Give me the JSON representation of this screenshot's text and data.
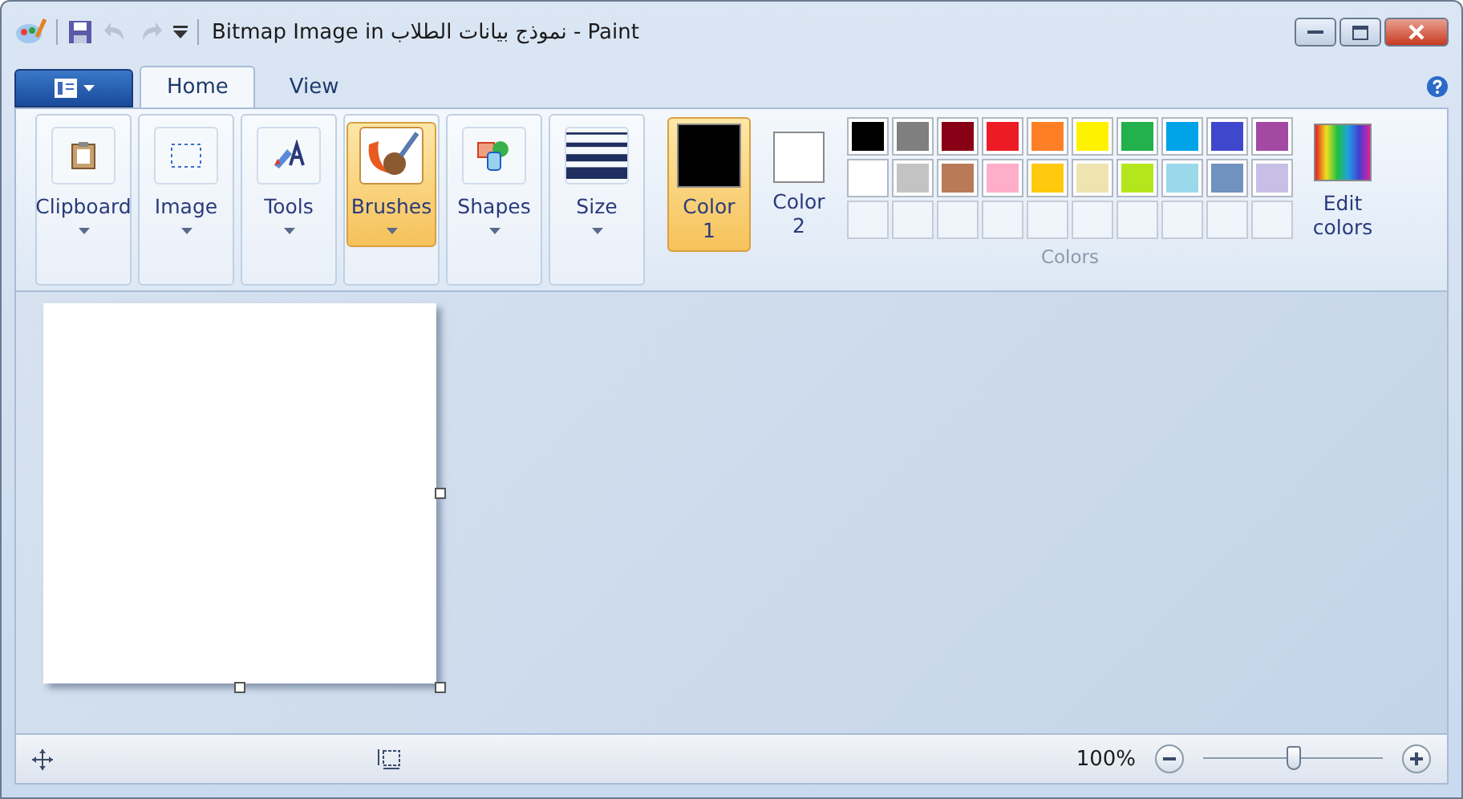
{
  "window": {
    "title": "Bitmap Image in نموذج بيانات الطلاب - Paint"
  },
  "tabs": [
    {
      "label": "Home",
      "selected": true
    },
    {
      "label": "View",
      "selected": false
    }
  ],
  "tools": [
    {
      "label": "Clipboard",
      "kind": "clipboard",
      "selected": false
    },
    {
      "label": "Image",
      "kind": "image",
      "selected": false
    },
    {
      "label": "Tools",
      "kind": "tools",
      "selected": false
    },
    {
      "label": "Brushes",
      "kind": "brushes",
      "selected": true
    },
    {
      "label": "Shapes",
      "kind": "shapes",
      "selected": false
    },
    {
      "label": "Size",
      "kind": "size",
      "selected": false
    }
  ],
  "color_slots": [
    {
      "label": "Color",
      "number": "1",
      "color": "#000000",
      "selected": true
    },
    {
      "label": "Color",
      "number": "2",
      "color": "#ffffff",
      "selected": false
    }
  ],
  "palette": [
    {
      "color": "#000000"
    },
    {
      "color": "#7f7f7f"
    },
    {
      "color": "#880015"
    },
    {
      "color": "#ed1c24"
    },
    {
      "color": "#ff7f27"
    },
    {
      "color": "#fff200"
    },
    {
      "color": "#22b14c"
    },
    {
      "color": "#00a2e8"
    },
    {
      "color": "#3f48cc"
    },
    {
      "color": "#a349a4"
    },
    {
      "color": "#ffffff"
    },
    {
      "color": "#c3c3c3"
    },
    {
      "color": "#b97a57"
    },
    {
      "color": "#ffaec9"
    },
    {
      "color": "#ffc90e"
    },
    {
      "color": "#efe4b0"
    },
    {
      "color": "#b5e61d"
    },
    {
      "color": "#99d9ea"
    },
    {
      "color": "#7092be"
    },
    {
      "color": "#c8bfe7"
    }
  ],
  "edit_colors": "Edit colors",
  "colors_group": "Colors",
  "status_bar": {
    "zoom": "100%",
    "zoom_slider": {
      "level": 0.5
    }
  }
}
